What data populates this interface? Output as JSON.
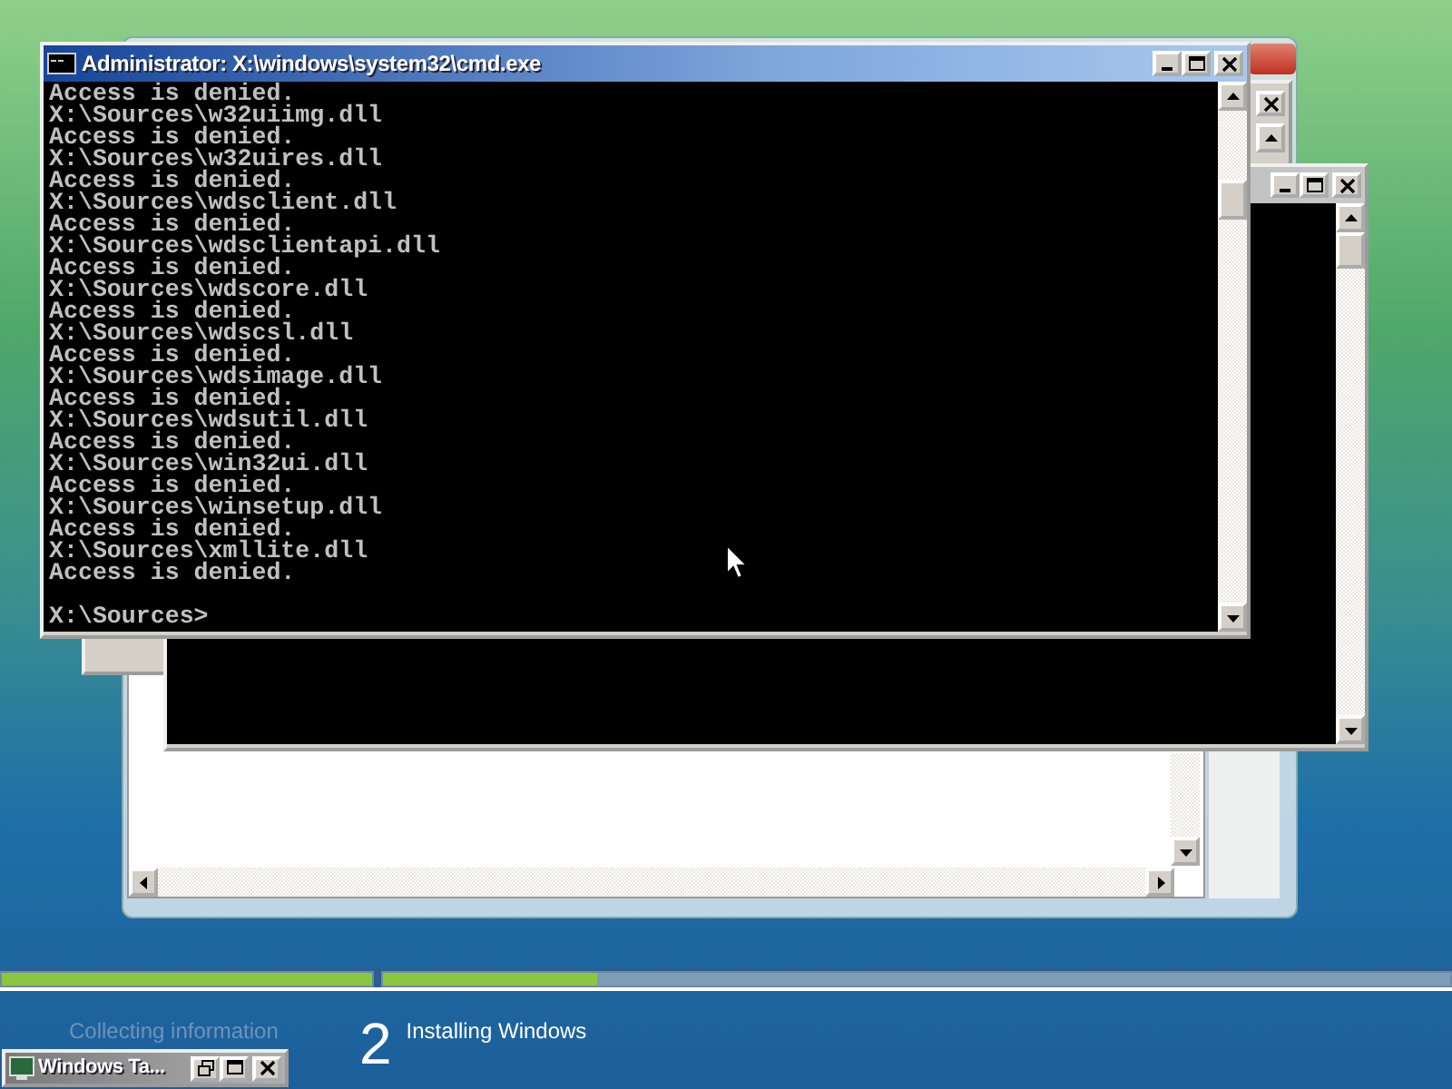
{
  "cmd_window": {
    "title": "Administrator: X:\\windows\\system32\\cmd.exe",
    "prompt": "X:\\Sources>",
    "lines": [
      "Access is denied.",
      "X:\\Sources\\w32uiimg.dll",
      "Access is denied.",
      "X:\\Sources\\w32uires.dll",
      "Access is denied.",
      "X:\\Sources\\wdsclient.dll",
      "Access is denied.",
      "X:\\Sources\\wdsclientapi.dll",
      "Access is denied.",
      "X:\\Sources\\wdscore.dll",
      "Access is denied.",
      "X:\\Sources\\wdscsl.dll",
      "Access is denied.",
      "X:\\Sources\\wdsimage.dll",
      "Access is denied.",
      "X:\\Sources\\wdsutil.dll",
      "Access is denied.",
      "X:\\Sources\\win32ui.dll",
      "Access is denied.",
      "X:\\Sources\\winsetup.dll",
      "Access is denied.",
      "X:\\Sources\\xmllite.dll",
      "Access is denied."
    ]
  },
  "setup_progress": {
    "steps": [
      {
        "label": "Collecting information",
        "level": 1,
        "current": false
      },
      {
        "number": "2",
        "label": "Installing Windows",
        "level": 0.2,
        "current": true
      }
    ]
  },
  "minimized_window": {
    "title": "Windows Ta..."
  }
}
